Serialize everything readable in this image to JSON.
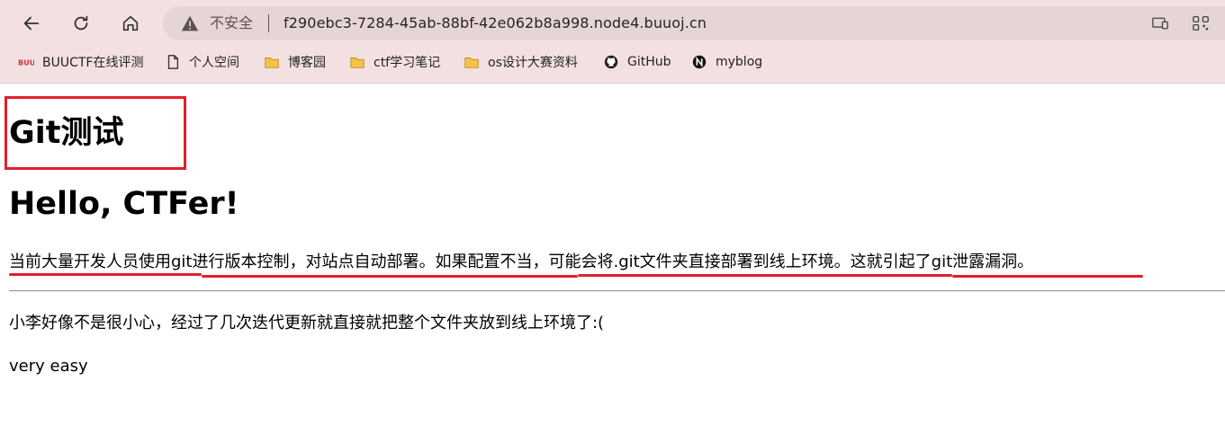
{
  "browser": {
    "security_label": "不安全",
    "url": "f290ebc3-7284-45ab-88bf-42e062b8a998.node4.buuoj.cn",
    "bookmarks": [
      {
        "label": "BUUCTF在线评测",
        "icon": "buuctf-icon"
      },
      {
        "label": "个人空间",
        "icon": "page-icon"
      },
      {
        "label": "博客园",
        "icon": "folder-icon"
      },
      {
        "label": "ctf学习笔记",
        "icon": "folder-icon"
      },
      {
        "label": "os设计大赛资料",
        "icon": "folder-icon"
      },
      {
        "label": "GitHub",
        "icon": "github-icon"
      },
      {
        "label": "myblog",
        "icon": "myblog-icon"
      }
    ]
  },
  "page": {
    "title": "Git测试",
    "greeting": "Hello, CTFer!",
    "intro": "当前大量开发人员使用git进行版本控制，对站点自动部署。如果配置不当，可能会将.git文件夹直接部署到线上环境。这就引起了git泄露漏洞。",
    "story": "小李好像不是很小心，经过了几次迭代更新就直接就把整个文件夹放到线上环境了:(",
    "difficulty": "very easy"
  },
  "colors": {
    "chrome_bg": "#f3e1e1",
    "address_bg": "#e6d5d5",
    "annotation_red": "#e0202c"
  }
}
